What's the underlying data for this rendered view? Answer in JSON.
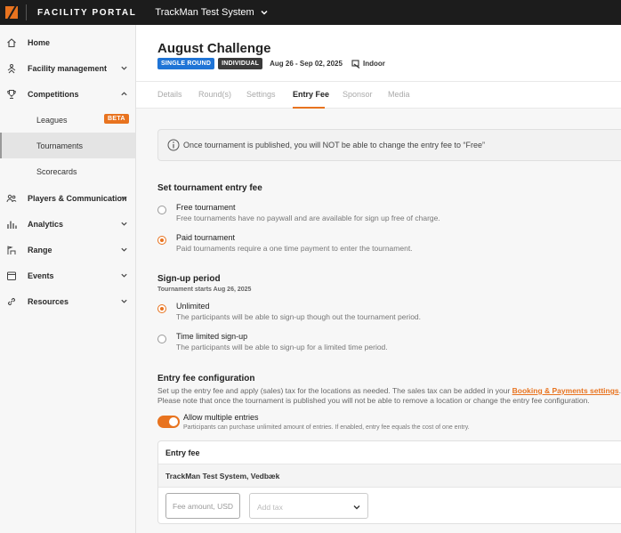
{
  "topbar": {
    "brand": "FACILITY PORTAL",
    "system_name": "TrackMan Test System"
  },
  "sidebar": {
    "items": [
      {
        "label": "Home",
        "icon": "home-icon",
        "expandable": false
      },
      {
        "label": "Facility management",
        "icon": "facility-icon",
        "expandable": true,
        "expanded": false
      },
      {
        "label": "Competitions",
        "icon": "trophy-icon",
        "expandable": true,
        "expanded": true
      },
      {
        "label": "Players & Communication",
        "icon": "players-icon",
        "expandable": true,
        "expanded": false
      },
      {
        "label": "Analytics",
        "icon": "analytics-icon",
        "expandable": true,
        "expanded": false
      },
      {
        "label": "Range",
        "icon": "range-icon",
        "expandable": true,
        "expanded": false
      },
      {
        "label": "Events",
        "icon": "calendar-icon",
        "expandable": true,
        "expanded": false
      },
      {
        "label": "Resources",
        "icon": "link-icon",
        "expandable": true,
        "expanded": false
      }
    ],
    "competitions_sub": [
      {
        "label": "Leagues",
        "badge": "BETA"
      },
      {
        "label": "Tournaments",
        "active": true
      },
      {
        "label": "Scorecards"
      }
    ]
  },
  "header": {
    "title": "August Challenge",
    "badges": [
      "SINGLE ROUND",
      "INDIVIDUAL"
    ],
    "dates": "Aug 26 - Sep 02, 2025",
    "venue": "Indoor"
  },
  "tabs": [
    {
      "label": "Details",
      "active": false
    },
    {
      "label": "Round(s)",
      "active": false
    },
    {
      "label": "Settings",
      "active": false
    },
    {
      "label": "Entry Fee",
      "active": true
    },
    {
      "label": "Sponsor",
      "active": false
    },
    {
      "label": "Media",
      "active": false
    }
  ],
  "info_banner": "Once tournament is published, you will NOT be able to change the entry fee to “Free”",
  "entry_fee_section": {
    "title": "Set tournament entry fee",
    "options": [
      {
        "label": "Free tournament",
        "description": "Free tournaments have no paywall and are available for sign up free of charge.",
        "selected": false
      },
      {
        "label": "Paid tournament",
        "description": "Paid tournaments require a one time payment to enter the tournament.",
        "selected": true
      }
    ]
  },
  "signup_section": {
    "title": "Sign-up period",
    "subtitle": "Tournament starts Aug 26, 2025",
    "options": [
      {
        "label": "Unlimited",
        "description": "The participants will be able to sign-up though out the tournament period.",
        "selected": true
      },
      {
        "label": "Time limited sign-up",
        "description": "The participants will be able to sign-up for a limited time period.",
        "selected": false
      }
    ]
  },
  "config_section": {
    "title": "Entry fee configuration",
    "desc_part1": "Set up the entry fee and apply (sales) tax for the locations as needed. The sales tax can be added in your ",
    "desc_link": "Booking & Payments settings",
    "desc_part2": ".",
    "desc_line2": "Please note that once the tournament is published you will not be able to remove a location or change the entry fee configuration.",
    "toggle_label": "Allow multiple entries",
    "toggle_desc": "Participants can purchase unlimited amount of entries. If enabled, entry fee equals the cost of one entry.",
    "toggle_on": true
  },
  "fee_table": {
    "header": "Entry fee",
    "location": "TrackMan Test System, Vedbæk",
    "fee_placeholder": "Fee amount, USD",
    "tax_placeholder": "Add tax"
  },
  "colors": {
    "accent": "#e8731f",
    "badge_blue": "#1f74d6",
    "topbar": "#1c1c1c"
  }
}
